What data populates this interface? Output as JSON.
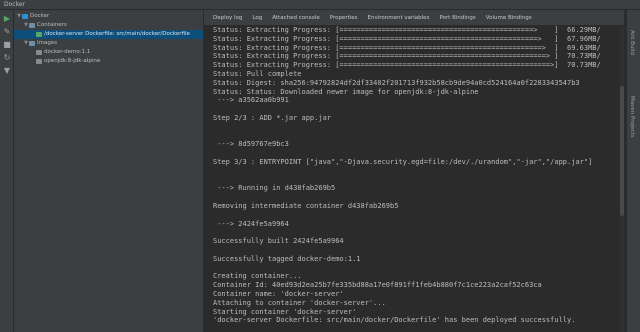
{
  "window": {
    "title": "Docker"
  },
  "toolbar_icons": [
    "deploy-icon",
    "edit-icon",
    "stop-icon",
    "refresh-icon",
    "filter-icon"
  ],
  "sidebar": {
    "items": [
      {
        "label": "Docker",
        "level": 0,
        "expanded": true,
        "icon": "docker-icon"
      },
      {
        "label": "Containers",
        "level": 1,
        "expanded": true,
        "icon": "folder-icon"
      },
      {
        "label": "/docker-server Dockerfile: src/main/docker/Dockerfile",
        "level": 2,
        "selected": true,
        "icon": "container-icon"
      },
      {
        "label": "Images",
        "level": 1,
        "expanded": true,
        "icon": "folder-icon"
      },
      {
        "label": "docker-demo:1.1",
        "level": 2,
        "icon": "image-icon"
      },
      {
        "label": "openjdk:8-jdk-alpine",
        "level": 2,
        "icon": "image-icon"
      }
    ]
  },
  "tabs": [
    "Deploy log",
    "Log",
    "Attached console",
    "Properties",
    "Environment variables",
    "Port Bindings",
    "Volume Bindings"
  ],
  "console": {
    "lines": [
      "Status: Extracting Progress: [==============================================>    ]  66.29MB/",
      "Status: Extracting Progress: [===============================================>   ]  67.96MB/",
      "Status: Extracting Progress: [================================================>  ]  69.63MB/",
      "Status: Extracting Progress: [=================================================> ]  70.73MB/",
      "Status: Extracting Progress: [==================================================>]  70.73MB/",
      "Status: Pull complete",
      "Status: Digest: sha256:94792824df2df33402f201713f932b58cb9de94a0cd524164a0f2283343547b3",
      "Status: Status: Downloaded newer image for openjdk:8-jdk-alpine",
      " ---> a3562aa0b991",
      "",
      "Step 2/3 : ADD *.jar app.jar",
      "",
      "",
      " ---> 8d59767e9bc3",
      "",
      "Step 3/3 : ENTRYPOINT [\"java\",\"-Djava.security.egd=file:/dev/./urandom\",\"-jar\",\"/app.jar\"]",
      "",
      "",
      " ---> Running in d438fab269b5",
      "",
      "Removing intermediate container d438fab269b5",
      "",
      " ---> 2424fe5a9964",
      "",
      "Successfully built 2424fe5a9964",
      "",
      "Successfully tagged docker-demo:1.1",
      "",
      "Creating container...",
      "Container Id: 40ed93d2ea25b7fe335bd88a17e0f891ff1feb4b880f7c1ce223a2caf52c63ca",
      "Container name: 'docker-server'",
      "Attaching to container 'docker-server'...",
      "Starting container 'docker-server'",
      "'docker-server Dockerfile: src/main/docker/Dockerfile' has been deployed successfully."
    ]
  },
  "right_panel_labels": [
    "Ant Build",
    "Maven Projects"
  ]
}
